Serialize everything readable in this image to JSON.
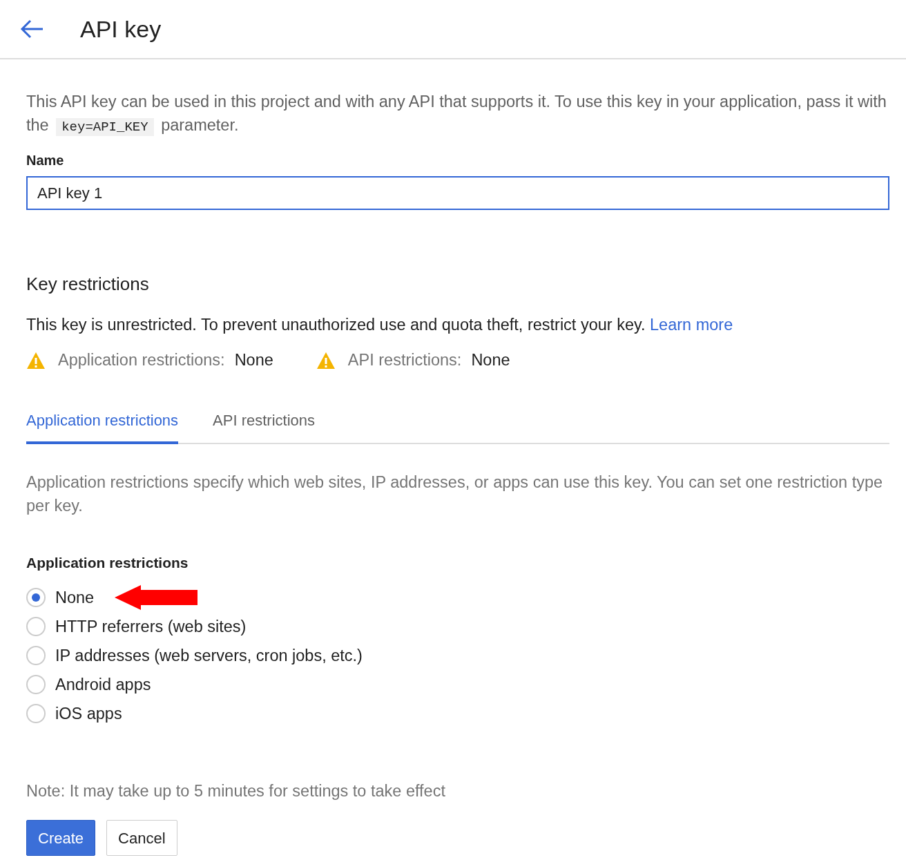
{
  "header": {
    "title": "API key"
  },
  "intro": {
    "before": "This API key can be used in this project and with any API that supports it. To use this key in your application, pass it with the",
    "code": "key=API_KEY",
    "after": "parameter."
  },
  "name_field": {
    "label": "Name",
    "value": "API key 1"
  },
  "key_restrictions": {
    "heading": "Key restrictions",
    "text": "This key is unrestricted. To prevent unauthorized use and quota theft, restrict your key.",
    "link": "Learn more",
    "warnings": [
      {
        "label": "Application restrictions:",
        "value": "None"
      },
      {
        "label": "API restrictions:",
        "value": "None"
      }
    ]
  },
  "tabs": [
    {
      "label": "Application restrictions",
      "selected": true
    },
    {
      "label": "API restrictions",
      "selected": false
    }
  ],
  "tab_description": "Application restrictions specify which web sites, IP addresses, or apps can use this key. You can set one restriction type per key.",
  "options_heading": "Application restrictions",
  "options": [
    {
      "label": "None",
      "selected": true,
      "pointed_at": true
    },
    {
      "label": "HTTP referrers (web sites)",
      "selected": false,
      "pointed_at": false
    },
    {
      "label": "IP addresses (web servers, cron jobs, etc.)",
      "selected": false,
      "pointed_at": false
    },
    {
      "label": "Android apps",
      "selected": false,
      "pointed_at": false
    },
    {
      "label": "iOS apps",
      "selected": false,
      "pointed_at": false
    }
  ],
  "note": "Note: It may take up to 5 minutes for settings to take effect",
  "buttons": [
    {
      "label": "Create",
      "kind": "primary"
    },
    {
      "label": "Cancel",
      "kind": "secondary"
    }
  ]
}
